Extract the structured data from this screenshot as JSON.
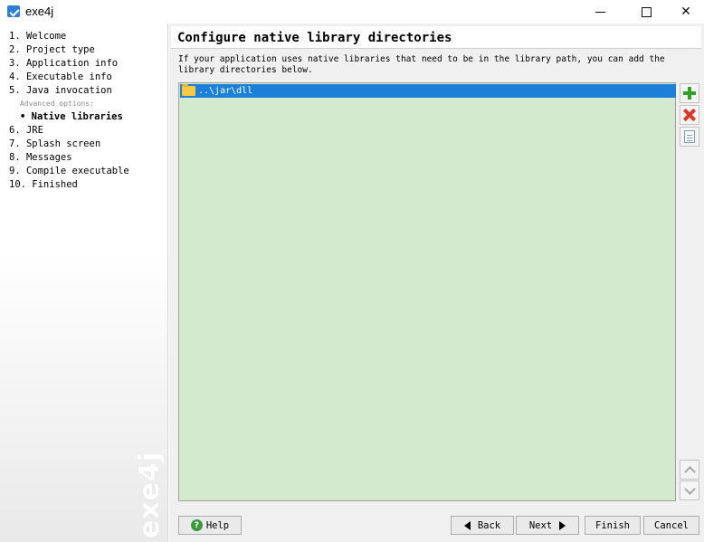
{
  "window": {
    "title": "exe4j",
    "app_icon": "exe4j-app-icon"
  },
  "sidebar": {
    "steps": [
      "1. Welcome",
      "2. Project type",
      "3. Application info",
      "4. Executable info",
      "5. Java invocation"
    ],
    "advanced_label": "Advanced options:",
    "active_step": "• Native libraries",
    "steps_after": [
      "6. JRE",
      "7. Splash screen",
      "8. Messages",
      "9. Compile executable",
      "10. Finished"
    ],
    "watermark": "exe4j"
  },
  "main": {
    "title": "Configure native library directories",
    "description": "If your application uses native libraries that need to be in the library path, you can add the library directories below.",
    "list": {
      "items": [
        {
          "label": "..\\jar\\dll",
          "icon": "folder-icon",
          "selected": true
        }
      ],
      "background": "#d3eacf",
      "selection_color": "#1c7fd8"
    },
    "side_buttons": {
      "add_icon": "add-icon",
      "remove_icon": "remove-icon",
      "edit_icon": "edit-icon",
      "up_icon": "move-up-icon",
      "down_icon": "move-down-icon"
    }
  },
  "footer": {
    "help_label": "Help",
    "back_label": "Back",
    "next_label": "Next",
    "finish_label": "Finish",
    "cancel_label": "Cancel"
  }
}
